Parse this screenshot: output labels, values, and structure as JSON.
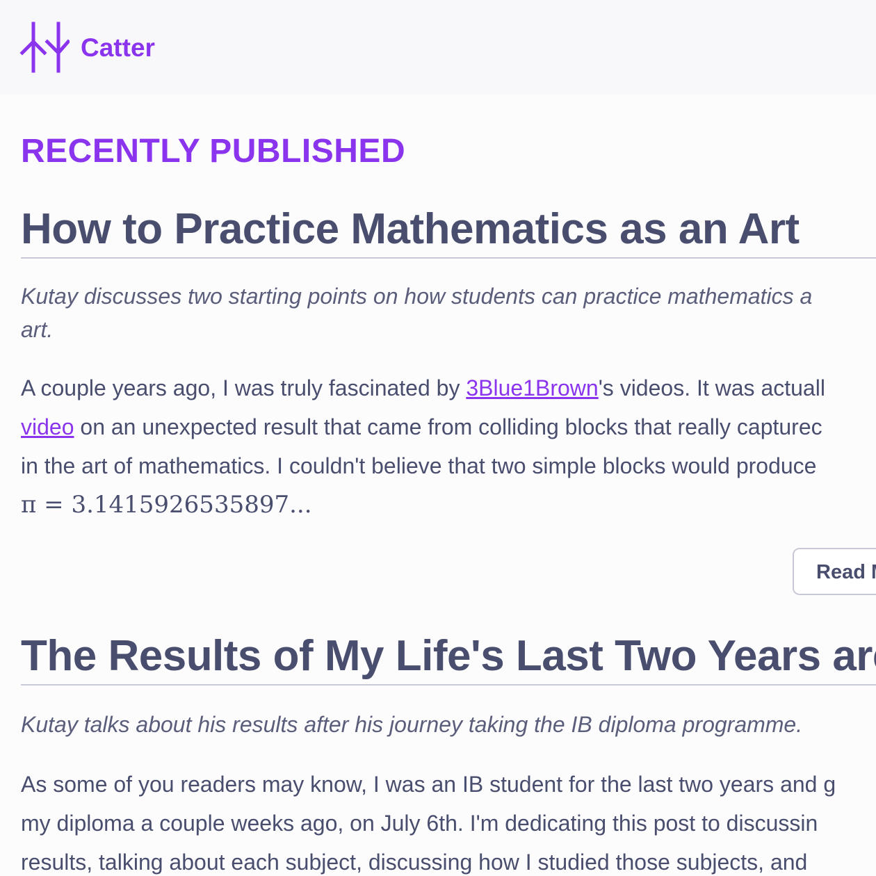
{
  "site": {
    "name": "Catter",
    "brand_color": "#8a34ee",
    "logo_icon": "catter-logo-icon"
  },
  "section": {
    "title": "RECENTLY PUBLISHED"
  },
  "posts": [
    {
      "title": "How to Practice Mathematics as an Art",
      "description_line1": "Kutay discusses two starting points on how students can practice mathematics a",
      "description_line2": "art.",
      "body_segment1": "A couple years ago, I was truly fascinated by ",
      "link1": "3Blue1Brown",
      "body_segment2": "'s videos. It was actuall",
      "link2": "video",
      "body_segment3": " on an unexpected result that came from colliding blocks that really capturec",
      "body_segment4": "in the art of mathematics. I couldn't believe that two simple blocks would produce",
      "math": "π = 3.1415926535897...",
      "read_more_label": "Read More:"
    },
    {
      "title": "The Results of My Life's Last Two Years are O",
      "description": "Kutay talks about his results after his journey taking the IB diploma programme.",
      "body_line1": "As some of you readers may know, I was an IB student for the last two years and g",
      "body_line2": "my diploma a couple weeks ago, on July 6th. I'm dedicating this post to discussin",
      "body_line3": "results, talking about each subject, discussing how I studied those subjects, and"
    }
  ]
}
